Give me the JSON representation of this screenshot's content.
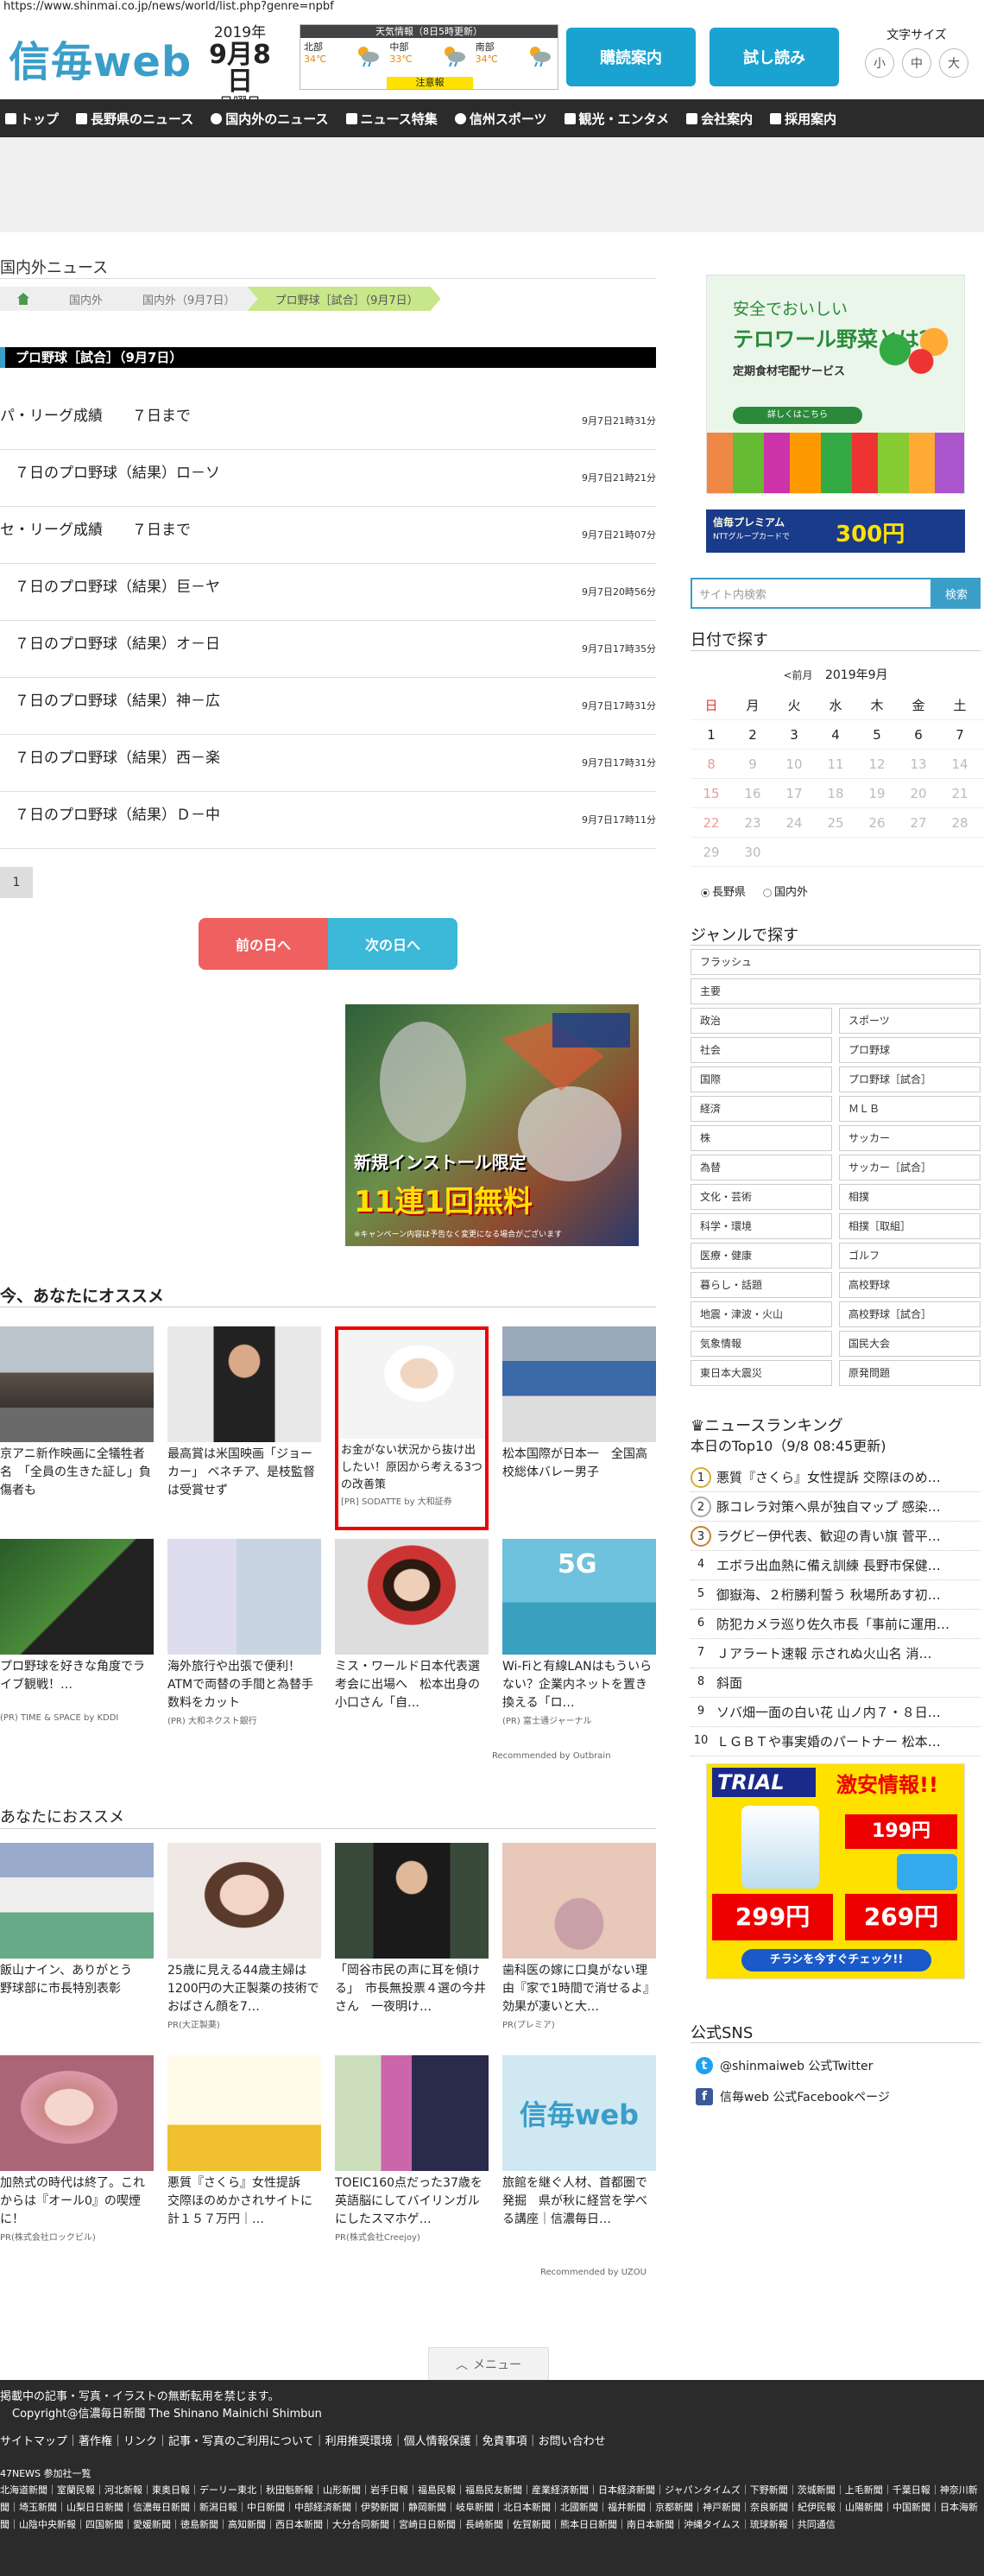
{
  "browser": {
    "url": "https://www.shinmai.co.jp/news/world/list.php?genre=npbf"
  },
  "header": {
    "logo": "信毎web",
    "date": {
      "year": "2019年",
      "month_day": "9月8日",
      "weekday": "日曜日"
    },
    "weather": {
      "title": "天気情報（8日5時更新）",
      "regions": [
        {
          "name": "北部",
          "temp": "34℃"
        },
        {
          "name": "中部",
          "temp": "33℃"
        },
        {
          "name": "南部",
          "temp": "34℃"
        }
      ],
      "alert": "注意報"
    },
    "buttons": {
      "subscribe": "購読案内",
      "trial": "試し読み"
    },
    "font_size": {
      "label": "文字サイズ",
      "small": "小",
      "medium": "中",
      "large": "大"
    }
  },
  "nav": {
    "items": [
      "トップ",
      "長野県のニュース",
      "国内外のニュース",
      "ニュース特集",
      "信州スポーツ",
      "観光・エンタメ",
      "会社案内",
      "採用案内"
    ]
  },
  "section": {
    "title": "国内外ニュース"
  },
  "breadcrumb": [
    "国内外",
    "国内外（9月7日）",
    "プロ野球［試合］（9月7日）"
  ],
  "category": {
    "title": "プロ野球［試合］（9月7日）"
  },
  "news": [
    {
      "title": "パ・リーグ成績　　７日まで",
      "date": "9月7日21時31分"
    },
    {
      "title": "　７日のプロ野球（結果）ロ－ソ",
      "date": "9月7日21時21分"
    },
    {
      "title": "セ・リーグ成績　　７日まで",
      "date": "9月7日21時07分"
    },
    {
      "title": "　７日のプロ野球（結果）巨－ヤ",
      "date": "9月7日20時56分"
    },
    {
      "title": "　７日のプロ野球（結果）オ－日",
      "date": "9月7日17時35分"
    },
    {
      "title": "　７日のプロ野球（結果）神－広",
      "date": "9月7日17時31分"
    },
    {
      "title": "　７日のプロ野球（結果）西－楽",
      "date": "9月7日17時31分"
    },
    {
      "title": "　７日のプロ野球（結果）Ｄ－中",
      "date": "9月7日17時11分"
    }
  ],
  "pager": {
    "current": "1"
  },
  "day_nav": {
    "prev": "前の日へ",
    "next": "次の日へ"
  },
  "game_ad": {
    "headline": "新規インストール限定",
    "offer": "11連1回無料",
    "fine_print": "※キャンペーン内容は予告なく変更になる場合がございます"
  },
  "recommend1": {
    "title": "今、あなたにオススメ",
    "items": [
      {
        "text": "京アニ新作映画に全犠牲者名　「全員の生きた証し」負傷者も",
        "source": ""
      },
      {
        "text": "最高賞は米国映画「ジョーカー」 ベネチア、是枝監督は受賞せず",
        "source": ""
      },
      {
        "text": "お金がない状況から抜け出したい！原因から考える3つの改善策",
        "source": "[PR] SODATTE by 大和証券"
      },
      {
        "text": "松本国際が日本一　全国高校総体バレー男子",
        "source": ""
      },
      {
        "text": "プロ野球を好きな角度でライブ観戦！…",
        "source": "(PR) TIME & SPACE by KDDI"
      },
      {
        "text": "海外旅行や出張で便利！ATMで両替の手間と為替手数料をカット",
        "source": "(PR) 大和ネクスト銀行"
      },
      {
        "text": "ミス・ワールド日本代表選考会に出場へ　松本出身の小口さん「自…",
        "source": ""
      },
      {
        "text": "Wi-Fiと有線LANはもういらない？企業内ネットを置き換える「ロ…",
        "source": "(PR) 富士通ジャーナル"
      }
    ],
    "credit": "Recommended by Outbrain"
  },
  "recommend2": {
    "title": "あなたにおススメ",
    "items": [
      {
        "text": "飯山ナイン、ありがとう　野球部に市長特別表彰",
        "source": ""
      },
      {
        "text": "25歳に見える44歳主婦は1200円の大正製薬の技術でおばさん顔を7…",
        "source": "PR(大正製薬)"
      },
      {
        "text": "「岡谷市民の声に耳を傾ける」　市長無投票４選の今井さん　一夜明け…",
        "source": ""
      },
      {
        "text": "歯科医の嫁に口臭がない理由『家で1時間で消せるよ』効果が凄いと大…",
        "source": "PR(プレミア)"
      },
      {
        "text": "加熱式の時代は終了。これからは『オール0』の喫煙に！",
        "source": "PR(株式会社ロックビル)"
      },
      {
        "text": "悪質『さくら』女性提訴　交際ほのめかされサイトに計１５７万円｜…",
        "source": ""
      },
      {
        "text": "TOEIC160点だった37歳を英語脳にしてバイリンガルにしたスマホゲ…",
        "source": "PR(株式会社Creejoy)"
      },
      {
        "text": "旅館を継ぐ人材、首都圏で発掘　県が秋に経営を学べる講座｜信濃毎日…",
        "source": ""
      }
    ],
    "credit": "Recommended by UZOU"
  },
  "sidebar": {
    "ad_veg": {
      "line1": "安全でおいしい",
      "line2": "テロワール野菜とは？",
      "line3": "定期食材宅配サービス",
      "button": "詳しくはこちら"
    },
    "ad_premium": {
      "name": "信毎プレミアム",
      "sub": "NTTグループカードで",
      "amount": "300円"
    },
    "search": {
      "placeholder": "サイト内検索",
      "button": "検索"
    },
    "date_search": {
      "title": "日付で探す",
      "prev": "<前月",
      "month": "2019年9月",
      "weekdays": [
        "日",
        "月",
        "火",
        "水",
        "木",
        "金",
        "土"
      ],
      "weeks": [
        [
          "1",
          "2",
          "3",
          "4",
          "5",
          "6",
          "7"
        ],
        [
          "8",
          "9",
          "10",
          "11",
          "12",
          "13",
          "14"
        ],
        [
          "15",
          "16",
          "17",
          "18",
          "19",
          "20",
          "21"
        ],
        [
          "22",
          "23",
          "24",
          "25",
          "26",
          "27",
          "28"
        ],
        [
          "29",
          "30",
          "",
          "",
          "",
          "",
          ""
        ]
      ],
      "regions": [
        "長野県",
        "国内外"
      ]
    },
    "genre": {
      "title": "ジャンルで探す",
      "full": [
        "フラッシュ",
        "主要"
      ],
      "items": [
        "政治",
        "スポーツ",
        "社会",
        "プロ野球",
        "国際",
        "プロ野球［試合］",
        "経済",
        "ＭＬＢ",
        "株",
        "サッカー",
        "為替",
        "サッカー［試合］",
        "文化・芸術",
        "相撲",
        "科学・環境",
        "相撲［取組］",
        "医療・健康",
        "ゴルフ",
        "暮らし・話題",
        "高校野球",
        "地震・津波・火山",
        "高校野球［試合］",
        "気象情報",
        "国民大会",
        "東日本大震災",
        "原発問題"
      ]
    },
    "ranking": {
      "title": "ニュースランキング",
      "subtitle": "本日のTop10（9/8 08:45更新)",
      "items": [
        "悪質『さくら』女性提訴 交際ほのめ…",
        "豚コレラ対策へ県が独自マップ 感染…",
        "ラグビー伊代表、歓迎の青い旗 菅平…",
        "エボラ出血熱に備え訓練 長野市保健…",
        "御嶽海、２桁勝利誓う 秋場所あす初…",
        "防犯カメラ巡り佐久市長「事前に運用…",
        "Ｊアラート速報 示されぬ火山名 消…",
        "斜面",
        "ソバ畑一面の白い花 山ノ内７・８日…",
        "ＬＧＢＴや事実婚のパートナー 松本…"
      ]
    },
    "ad_trial": {
      "brand": "TRIAL",
      "tagline": "激安情報!!",
      "price1": "299円",
      "price2": "199円",
      "price3": "269円",
      "cta": "チラシを今すぐチェック!!"
    },
    "sns": {
      "title": "公式SNS",
      "twitter": "@shinmaiweb 公式Twitter",
      "facebook": "信毎web 公式Facebookページ"
    }
  },
  "menu_tab": "メニュー",
  "footer": {
    "notice": "掲載中の記事・写真・イラストの無断転用を禁じます。",
    "copyright": "Copyright@信濃毎日新聞 The Shinano Mainichi Shimbun",
    "links": "サイトマップ｜著作権｜リンク｜記事・写真のご利用について｜利用推奨環境｜個人情報保護｜免責事項｜お問い合わせ",
    "network_title": "47NEWS 参加社一覧",
    "network": "北海道新聞｜室蘭民報｜河北新報｜東奥日報｜デーリー東北｜秋田魁新報｜山形新聞｜岩手日報｜福島民報｜福島民友新聞｜産業経済新聞｜日本経済新聞｜ジャパンタイムズ｜下野新聞｜茨城新聞｜上毛新聞｜千葉日報｜神奈川新聞｜埼玉新聞｜山梨日日新聞｜信濃毎日新聞｜新潟日報｜中日新聞｜中部経済新聞｜伊勢新聞｜静岡新聞｜岐阜新聞｜北日本新聞｜北國新聞｜福井新聞｜京都新聞｜神戸新聞｜奈良新聞｜紀伊民報｜山陽新聞｜中国新聞｜日本海新聞｜山陰中央新報｜四国新聞｜愛媛新聞｜徳島新聞｜高知新聞｜西日本新聞｜大分合同新聞｜宮崎日日新聞｜長崎新聞｜佐賀新聞｜熊本日日新聞｜南日本新聞｜沖縄タイムス｜琉球新報｜共同通信"
  },
  "colors": {
    "brand": "#3a9ec9",
    "button": "#1aa3d0",
    "nav": "#2b2b2b",
    "prev_day": "#ef6060",
    "next_day": "#3cb8d8",
    "crumb_current": "#c8e68a",
    "highlight": "#ee0000"
  }
}
